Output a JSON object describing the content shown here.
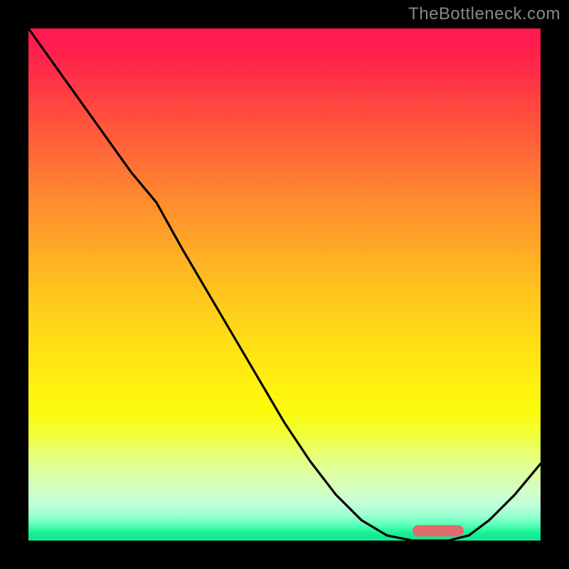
{
  "watermark": "TheBottleneck.com",
  "colors": {
    "curve_stroke": "#000000",
    "marker_fill": "#e06a6e",
    "frame_bg_top": "#ff1850",
    "frame_bg_bottom": "#10e890",
    "page_bg": "#000000"
  },
  "chart_data": {
    "type": "line",
    "title": "",
    "xlabel": "",
    "ylabel": "",
    "xlim": [
      0,
      100
    ],
    "ylim": [
      0,
      100
    ],
    "grid": false,
    "legend": null,
    "series": [
      {
        "name": "curve",
        "x": [
          0,
          5,
          10,
          15,
          20,
          25,
          30,
          35,
          40,
          45,
          50,
          55,
          60,
          65,
          70,
          75,
          78,
          82,
          86,
          90,
          95,
          100
        ],
        "y": [
          100,
          93,
          86,
          79,
          72,
          66,
          57,
          48.5,
          40,
          31.5,
          23,
          15.5,
          9,
          4,
          1,
          0,
          0,
          0,
          1,
          4,
          9,
          15
        ]
      }
    ],
    "marker": {
      "shape": "rounded-bar",
      "x_start": 75,
      "x_end": 85,
      "y": 0.8,
      "height": 2.2
    }
  }
}
